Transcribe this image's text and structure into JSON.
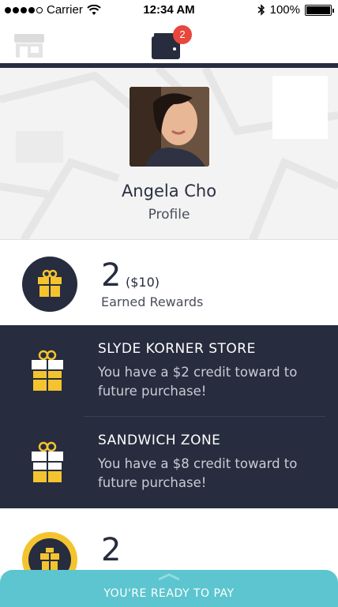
{
  "status_bar": {
    "carrier": "Carrier",
    "time": "12:34 AM",
    "battery": "100%"
  },
  "nav": {
    "wallet_badge_count": "2",
    "store_icon": "store-icon",
    "wallet_icon": "wallet-icon"
  },
  "profile": {
    "name": "Angela Cho",
    "subtitle": "Profile"
  },
  "earned": {
    "count": "2",
    "amount": "($10)",
    "label": "Earned Rewards"
  },
  "rewards": [
    {
      "title": "SLYDE KORNER STORE",
      "description": "You have a $2 credit toward to future purchase!"
    },
    {
      "title": "SANDWICH ZONE",
      "description": "You have a $8 credit toward to future purchase!"
    }
  ],
  "points": {
    "count": "2"
  },
  "pay_bar": {
    "label": "YOU'RE READY TO PAY"
  },
  "colors": {
    "navy": "#272c3e",
    "accent_yellow": "#f4c430",
    "badge_red": "#e8473d",
    "pay_teal": "#5cc5cf"
  }
}
